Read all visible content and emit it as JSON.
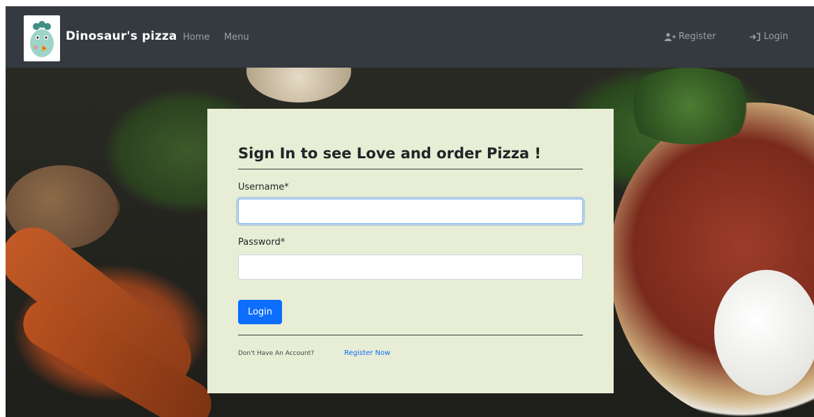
{
  "navbar": {
    "brand": "Dinosaur's pizza",
    "links": [
      "Home",
      "Menu"
    ],
    "register_label": "Register",
    "login_label": "Login",
    "register_icon": "user-plus-icon",
    "login_icon": "sign-in-icon",
    "background_color": "#343a40"
  },
  "login_form": {
    "title": "Sign In to see Love and order Pizza !",
    "username_label": "Username*",
    "username_value": "",
    "password_label": "Password*",
    "password_value": "",
    "submit_label": "Login",
    "footer_prompt": "Don't Have An Account?",
    "register_link": "Register Now",
    "card_color": "#e8eed5",
    "button_color": "#0d6efd"
  }
}
